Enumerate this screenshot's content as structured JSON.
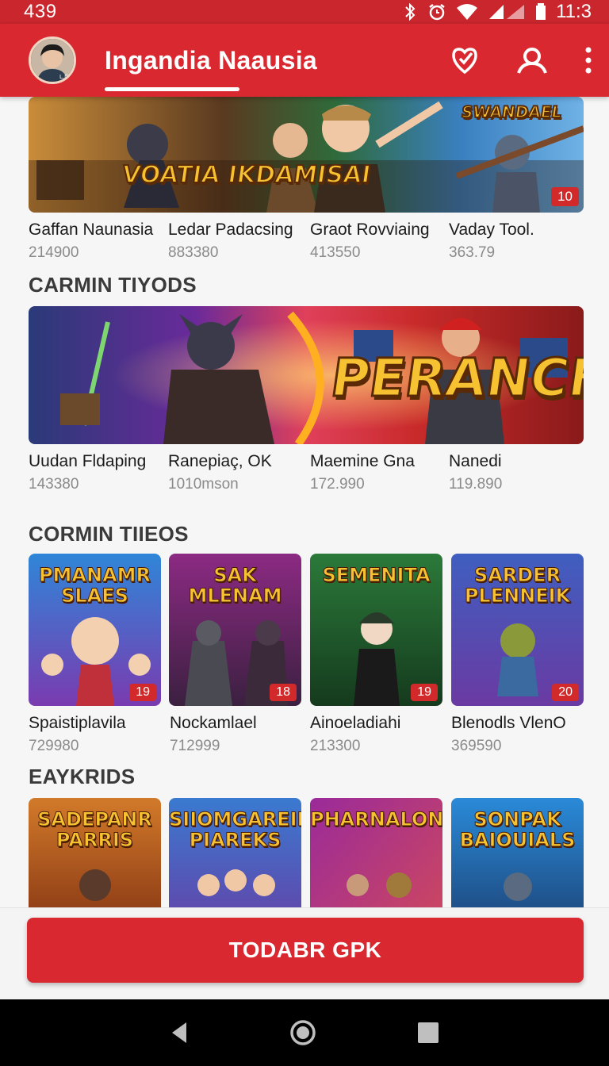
{
  "status_bar": {
    "time": "439",
    "clock": "11:3"
  },
  "app_bar": {
    "title": "Ingandia Naausia",
    "avatar_label": "L.D"
  },
  "banner1": {
    "art_text": "VOATIA IKDAMISAI",
    "corner_text": "SWANDAEL",
    "badge": "10",
    "items": [
      {
        "name": "Gaffan Naunasia",
        "count": "214900"
      },
      {
        "name": "Ledar Padacsing",
        "count": "883380"
      },
      {
        "name": "Graot Rovviaing",
        "count": "413550"
      },
      {
        "name": "Vaday Tool.",
        "count": "363.79"
      }
    ]
  },
  "section1": {
    "title": "CARMIN TIYODS"
  },
  "banner2": {
    "art_text": "PERANCH!",
    "items": [
      {
        "name": "Uudan Fldaping",
        "count": "143380"
      },
      {
        "name": "Ranepiaç, OK",
        "count": "1010mson"
      },
      {
        "name": "Maemine Gna",
        "count": "172.990"
      },
      {
        "name": "Nanedi",
        "count": "119.890"
      }
    ]
  },
  "section2": {
    "title": "CORMIN TIIEOS",
    "tiles": [
      {
        "art": "PMANAMR SLAES",
        "badge": "19",
        "name": "Spaistiplavila",
        "count": "729980",
        "bg1": "#2f86d8",
        "bg2": "#7a3bb0"
      },
      {
        "art": "SAK MLENAM",
        "badge": "18",
        "name": "Nockamlael",
        "count": "712999",
        "bg1": "#8c2a83",
        "bg2": "#3b2040"
      },
      {
        "art": "SEMENITA",
        "badge": "19",
        "name": "Ainoeladiahi",
        "count": "213300",
        "bg1": "#2b7a3a",
        "bg2": "#153a1d"
      },
      {
        "art": "SARDER PLENNEIK",
        "badge": "20",
        "name": "Blenodls VlenO",
        "count": "369590",
        "bg1": "#3f5fc0",
        "bg2": "#6a3aa2"
      }
    ]
  },
  "section3": {
    "title": "EAYKRIDS",
    "tiles": [
      {
        "art": "SADEPANR PARRIS",
        "bg1": "#d27a2a",
        "bg2": "#7a2a10"
      },
      {
        "art": "SIIOMGAREIK PIAREKS",
        "bg1": "#3a7ad0",
        "bg2": "#6a3aa2"
      },
      {
        "art": "PHARNALON",
        "bg1": "#9a2a9a",
        "bg2": "#d24a5a"
      },
      {
        "art": "SONPAK BAIOUIALS",
        "bg1": "#2a8ad8",
        "bg2": "#1a3a6a"
      }
    ]
  },
  "cta": {
    "label": "TODABR GPK"
  },
  "colors": {
    "accent": "#d9282f",
    "status_bar": "#c9262d",
    "badge": "#d22a2a"
  }
}
